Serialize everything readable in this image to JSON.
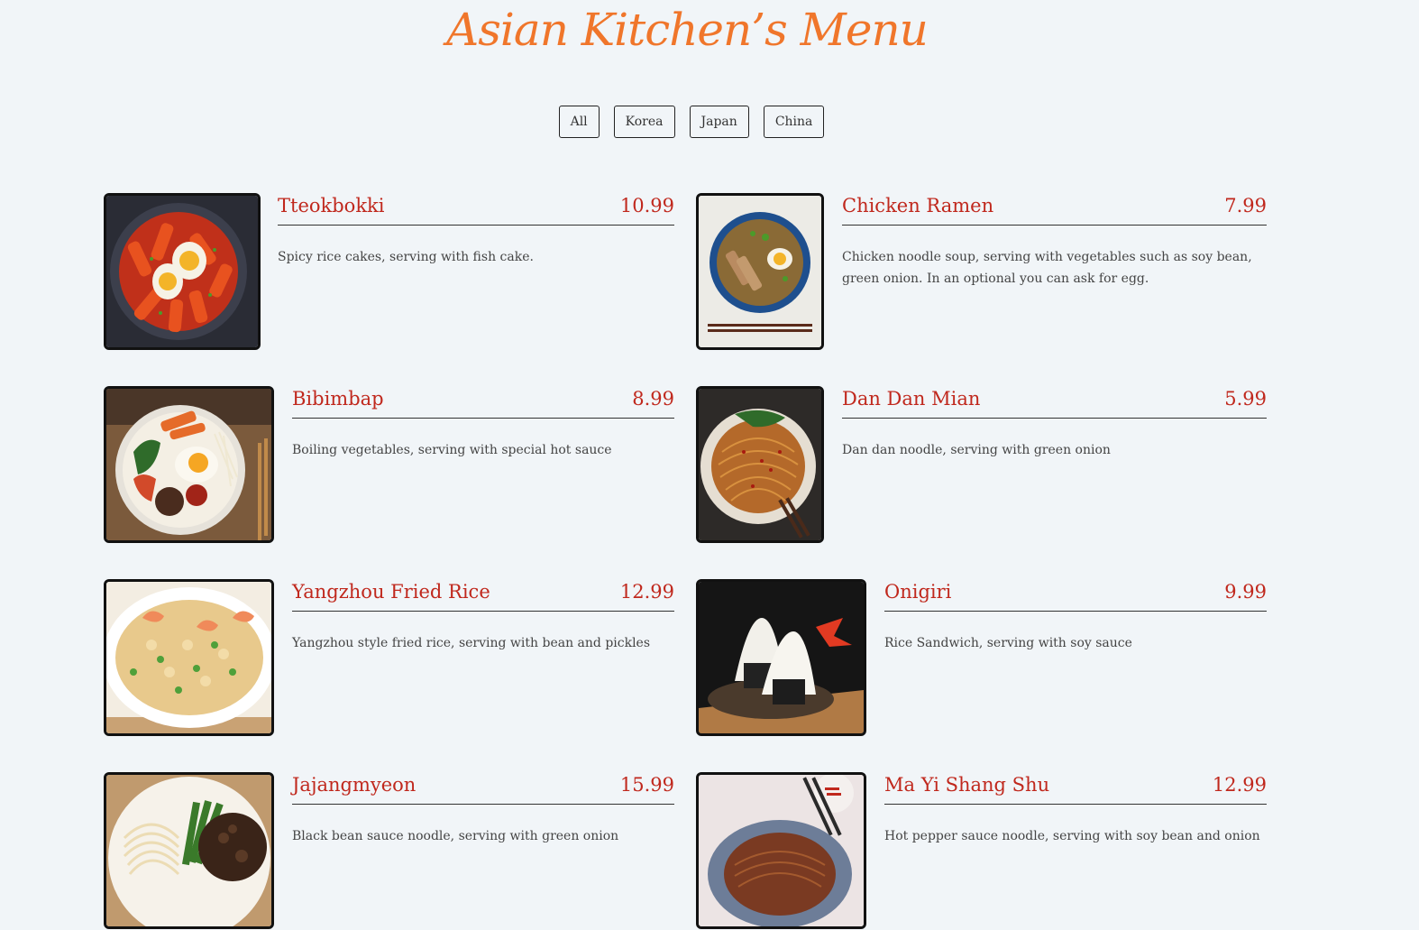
{
  "header": {
    "title": "Asian Kitchen’s Menu"
  },
  "filters": [
    {
      "label": "All"
    },
    {
      "label": "Korea"
    },
    {
      "label": "Japan"
    },
    {
      "label": "China"
    }
  ],
  "colors": {
    "title": "#f0762b",
    "item_name": "#c0281d",
    "background": "#f1f5f8"
  },
  "menu": [
    {
      "name": "Tteokbokki",
      "price": "10.99",
      "desc": "Spicy rice cakes, serving with fish cake.",
      "image": "tteokbokki-photo"
    },
    {
      "name": "Chicken Ramen",
      "price": "7.99",
      "desc": "Chicken noodle soup, serving with vegetables such as soy bean, green onion. In an optional you can ask for egg.",
      "image": "chicken-ramen-photo"
    },
    {
      "name": "Bibimbap",
      "price": "8.99",
      "desc": "Boiling vegetables, serving with special hot sauce",
      "image": "bibimbap-photo"
    },
    {
      "name": "Dan Dan Mian",
      "price": "5.99",
      "desc": "Dan dan noodle, serving with green onion",
      "image": "dan-dan-mian-photo"
    },
    {
      "name": "Yangzhou Fried Rice",
      "price": "12.99",
      "desc": "Yangzhou style fried rice, serving with bean and pickles",
      "image": "yangzhou-fried-rice-photo"
    },
    {
      "name": "Onigiri",
      "price": "9.99",
      "desc": "Rice Sandwich, serving with soy sauce",
      "image": "onigiri-photo"
    },
    {
      "name": "Jajangmyeon",
      "price": "15.99",
      "desc": "Black bean sauce noodle, serving with green onion",
      "image": "jajangmyeon-photo"
    },
    {
      "name": "Ma Yi Shang Shu",
      "price": "12.99",
      "desc": "Hot pepper sauce noodle, serving with soy bean and onion",
      "image": "ma-yi-shang-shu-photo"
    }
  ]
}
